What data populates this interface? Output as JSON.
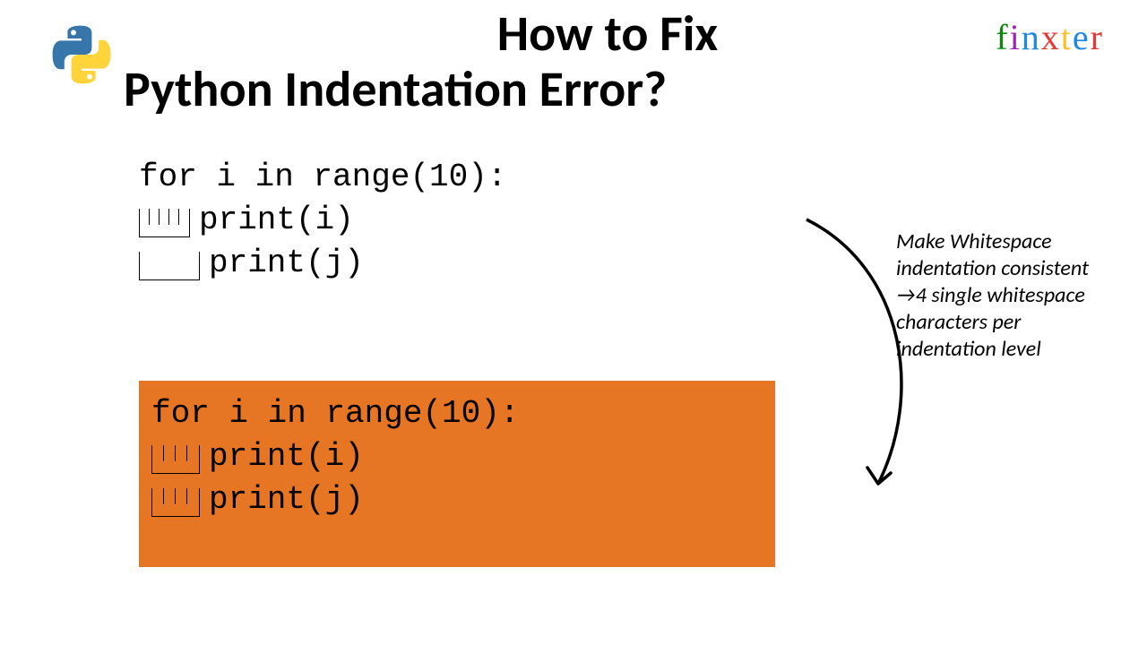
{
  "title": {
    "line1": "How to Fix",
    "line2": "Python Indentation Error?"
  },
  "brand": {
    "letters": [
      "f",
      "i",
      "n",
      "x",
      "t",
      "e",
      "r"
    ]
  },
  "code_top": {
    "l1": "for i in range(10):",
    "l2": "print(i)",
    "l3": "print(j)"
  },
  "code_bottom": {
    "l1": "for i in range(10):",
    "l2": "print(i)",
    "l3": "print(j)"
  },
  "note": "Make Whitespace indentation consistent →4 single whitespace characters per indentation level"
}
